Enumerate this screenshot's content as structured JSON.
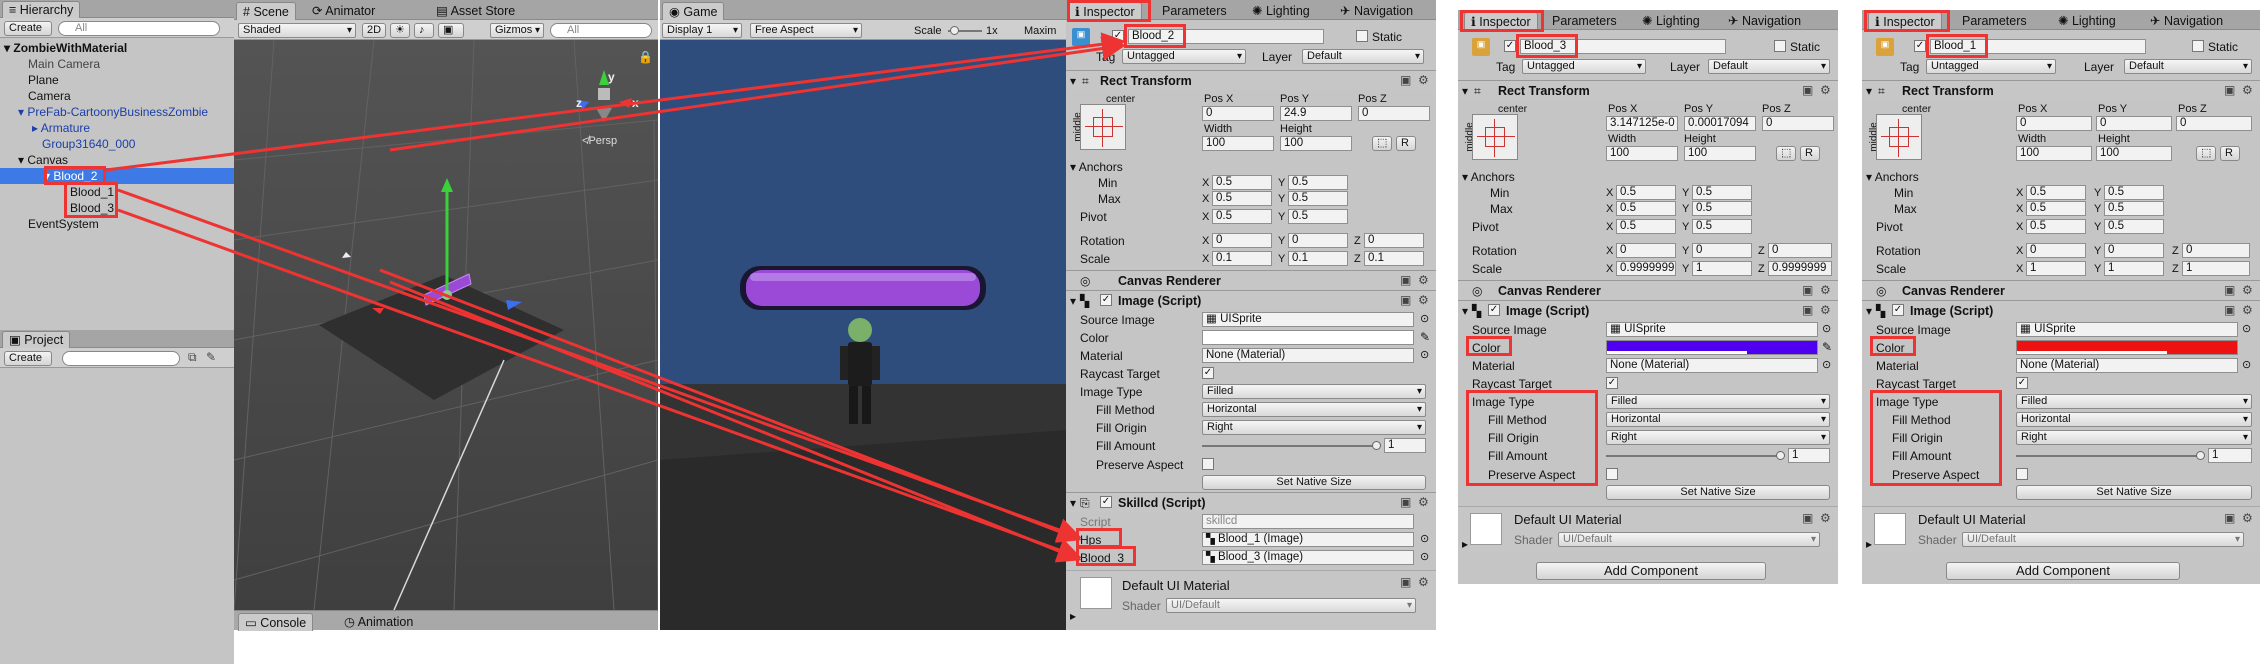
{
  "hierarchy": {
    "tab": "Hierarchy",
    "create": "Create",
    "search_placeholder": "All",
    "scene": "ZombieWithMaterial",
    "items": [
      "Main Camera",
      "Plane",
      "Camera",
      "PreFab-CartoonyBusinessZombie",
      "Armature",
      "Group31640_000",
      "Canvas",
      "Blood_2",
      "Blood_1",
      "Blood_3",
      "EventSystem"
    ]
  },
  "project": {
    "tab": "Project",
    "create": "Create"
  },
  "scene_view": {
    "tabs": [
      "Scene",
      "Animator",
      "Asset Store"
    ],
    "shading": "Shaded",
    "mode_2d": "2D",
    "gizmos": "Gizmos",
    "search_placeholder": "All",
    "persp": "Persp",
    "axis_y": "y",
    "axis_x": "x",
    "axis_z": "z"
  },
  "bottom_tabs": [
    "Console",
    "Animation"
  ],
  "game_view": {
    "tab": "Game",
    "display": "Display 1",
    "aspect": "Free Aspect",
    "scale_label": "Scale",
    "scale_value": "1x",
    "maximize": "Maxim"
  },
  "inspector1": {
    "tabs": [
      "Inspector",
      "Parameters",
      "Lighting",
      "Navigation"
    ],
    "name": "Blood_2",
    "static": "Static",
    "tag_label": "Tag",
    "tag": "Untagged",
    "layer_label": "Layer",
    "layer": "Default",
    "rect_transform": "Rect Transform",
    "anchor_preset": "center",
    "anchor_side": "middle",
    "pos_x_label": "Pos X",
    "pos_y_label": "Pos Y",
    "pos_z_label": "Pos Z",
    "pos_x": "0",
    "pos_y": "24.9",
    "pos_z": "0",
    "width_label": "Width",
    "height_label": "Height",
    "width": "100",
    "height": "100",
    "r_button": "R",
    "anchors": "Anchors",
    "min": "Min",
    "max": "Max",
    "pivot": "Pivot",
    "anchors_min_x": "0.5",
    "anchors_min_y": "0.5",
    "anchors_max_x": "0.5",
    "anchors_max_y": "0.5",
    "pivot_x": "0.5",
    "pivot_y": "0.5",
    "rotation": "Rotation",
    "rot_x": "0",
    "rot_y": "0",
    "rot_z": "0",
    "scale": "Scale",
    "scale_x": "0.1",
    "scale_y": "0.1",
    "scale_z": "0.1",
    "x": "X",
    "y": "Y",
    "z": "Z",
    "canvas_renderer": "Canvas Renderer",
    "image_script": "Image (Script)",
    "source_image_label": "Source Image",
    "source_image": "UISprite",
    "color_label": "Color",
    "color": "#ffffff",
    "material_label": "Material",
    "material": "None (Material)",
    "raycast_label": "Raycast Target",
    "image_type_label": "Image Type",
    "image_type": "Filled",
    "fill_method_label": "Fill Method",
    "fill_method": "Horizontal",
    "fill_origin_label": "Fill Origin",
    "fill_origin": "Right",
    "fill_amount_label": "Fill Amount",
    "fill_amount": "1",
    "preserve_label": "Preserve Aspect",
    "set_native": "Set Native Size",
    "skillcd": "Skillcd (Script)",
    "script_label": "Script",
    "script": "skillcd",
    "hps_label": "Hps",
    "hps": "Blood_1 (Image)",
    "blood3_label": "Blood_3",
    "blood3": "Blood_3 (Image)",
    "default_material": "Default UI Material",
    "shader_label": "Shader",
    "shader": "UI/Default"
  },
  "inspector2": {
    "tabs": [
      "Inspector",
      "Parameters",
      "Lighting",
      "Navigation"
    ],
    "name": "Blood_3",
    "pos_x": "3.147125e-0",
    "pos_y": "0.00017094",
    "pos_z": "0",
    "width": "100",
    "height": "100",
    "anchors_min_x": "0.5",
    "anchors_min_y": "0.5",
    "anchors_max_x": "0.5",
    "anchors_max_y": "0.5",
    "pivot_x": "0.5",
    "pivot_y": "0.5",
    "rot_x": "0",
    "rot_y": "0",
    "rot_z": "0",
    "scale_x": "0.9999999",
    "scale_y": "1",
    "scale_z": "0.9999999",
    "color": "#5000f0",
    "add_component": "Add Component"
  },
  "inspector3": {
    "tabs": [
      "Inspector",
      "Parameters",
      "Lighting",
      "Navigation"
    ],
    "name": "Blood_1",
    "pos_x": "0",
    "pos_y": "0",
    "pos_z": "0",
    "width": "100",
    "height": "100",
    "anchors_min_x": "0.5",
    "anchors_min_y": "0.5",
    "anchors_max_x": "0.5",
    "anchors_max_y": "0.5",
    "pivot_x": "0.5",
    "pivot_y": "0.5",
    "rot_x": "0",
    "rot_y": "0",
    "rot_z": "0",
    "scale_x": "1",
    "scale_y": "1",
    "scale_z": "1",
    "color": "#ee1111",
    "add_component": "Add Component"
  },
  "colors": {
    "annotation": "#ee3333",
    "selection": "#3d7ae5",
    "game_bg": "#2e4d7c",
    "health_bar": "#9b4ad8"
  }
}
